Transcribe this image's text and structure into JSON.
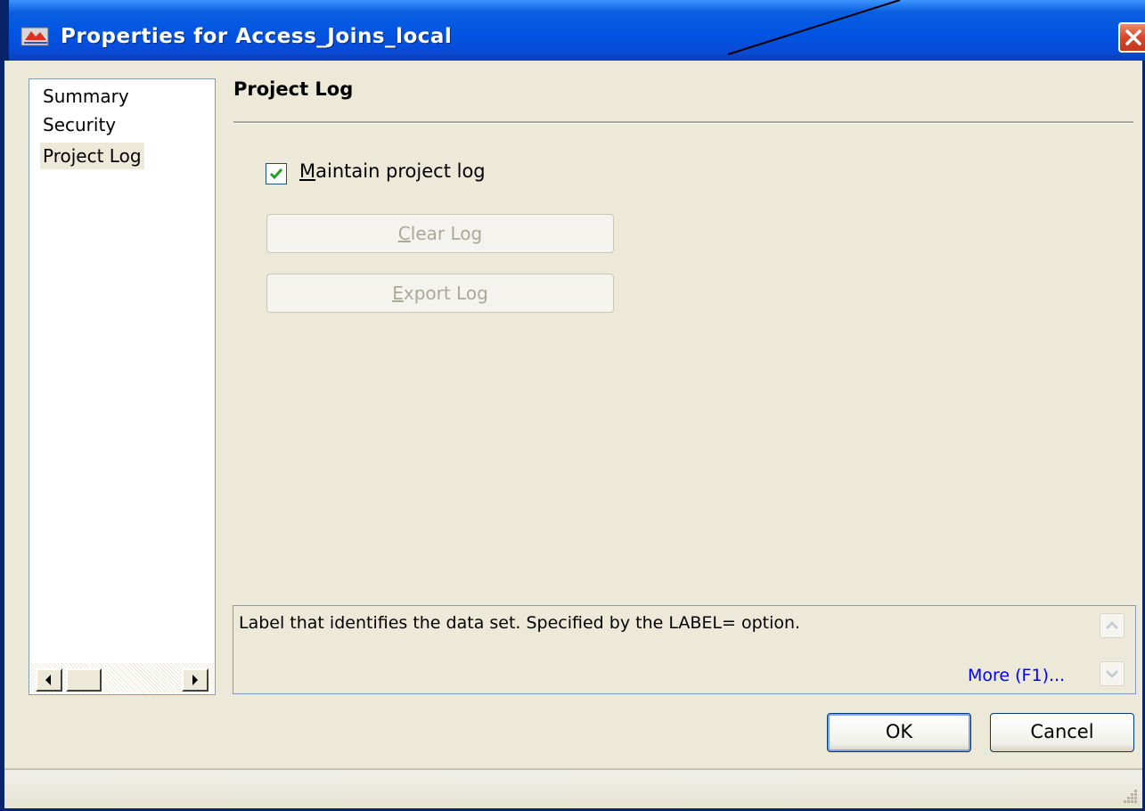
{
  "window": {
    "title": "Properties for Access_Joins_local"
  },
  "nav": {
    "items": [
      {
        "label": "Summary",
        "selected": false
      },
      {
        "label": "Security",
        "selected": false
      },
      {
        "label": "Project Log",
        "selected": true
      }
    ]
  },
  "content": {
    "heading": "Project Log",
    "maintain_log": {
      "checked": true,
      "mnemonic": "M",
      "label_rest": "aintain project log"
    },
    "clear_log": {
      "mnemonic": "C",
      "label_rest": "lear Log",
      "enabled": false
    },
    "export_log": {
      "mnemonic": "E",
      "label_rest": "xport Log",
      "enabled": false
    }
  },
  "description": {
    "text": "Label that identifies the data set. Specified by the LABEL= option.",
    "more_link": "More (F1)..."
  },
  "buttons": {
    "ok": "OK",
    "cancel": "Cancel"
  },
  "colors": {
    "titlebar": "#0054e3",
    "face": "#ece9d8",
    "link": "#0000ff",
    "checkmark": "#21a121"
  }
}
